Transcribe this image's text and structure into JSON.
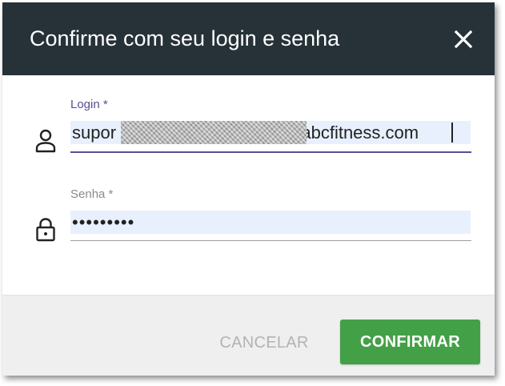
{
  "dialog": {
    "title": "Confirme com seu login e senha",
    "close_icon": "close-icon"
  },
  "login": {
    "label": "Login *",
    "icon": "person-icon",
    "value_prefix": "supor",
    "value_suffix": "@abcfitness.com",
    "value_redacted": true
  },
  "senha": {
    "label": "Senha *",
    "icon": "lock-icon",
    "value": "•••••••••"
  },
  "actions": {
    "cancel_label": "CANCELAR",
    "confirm_label": "CONFIRMAR"
  },
  "colors": {
    "header_bg": "#263238",
    "accent_purple": "#5b4c96",
    "confirm_green": "#43a047",
    "autofill_bg": "#e8f0fe",
    "footer_bg": "#efefef"
  }
}
